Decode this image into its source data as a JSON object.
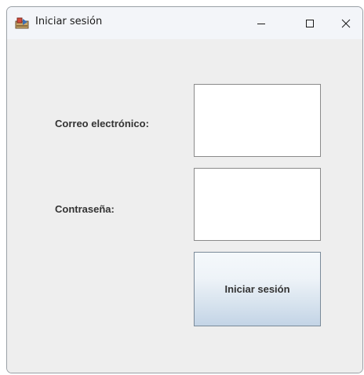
{
  "window": {
    "title": "Iniciar sesión",
    "controls": {
      "minimize": "minimize-icon",
      "maximize": "maximize-icon",
      "close": "close-icon"
    }
  },
  "form": {
    "email_label": "Correo electrónico:",
    "email_value": "",
    "password_label": "Contraseña:",
    "password_value": "",
    "submit_label": "Iniciar sesión"
  },
  "colors": {
    "window_bg": "#eeeeee",
    "titlebar_bg": "#f3f5f9",
    "field_bg": "#ffffff",
    "field_border": "#8a8a8a",
    "button_gradient_top": "#f5f9fc",
    "button_gradient_bottom": "#c3d4e6",
    "label_text": "#333333"
  }
}
